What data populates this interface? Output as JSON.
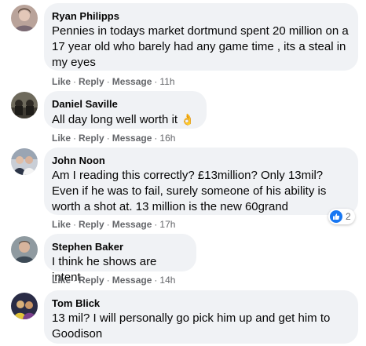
{
  "comments": [
    {
      "name": "Ryan Philipps",
      "text": "Pennies in todays market dortmund spent 20 million on a 17 year old who barely had any game time , its a steal in my eyes",
      "actions": {
        "like": "Like",
        "reply": "Reply",
        "message": "Message",
        "time": "11h"
      }
    },
    {
      "name": "Daniel Saville",
      "text": "All day long well worth it",
      "emoji": "👌",
      "actions": {
        "like": "Like",
        "reply": "Reply",
        "message": "Message",
        "time": "16h"
      }
    },
    {
      "name": "John Noon",
      "text": "Am I reading this correctly? £13million? Only 13mil? Even if he was to fail, surely someone of his ability is worth a shot at. 13 million is the new 60grand",
      "reaction_count": "2",
      "actions": {
        "like": "Like",
        "reply": "Reply",
        "message": "Message",
        "time": "17h"
      }
    },
    {
      "name": "Stephen Baker",
      "text": "I think he shows are intent",
      "actions": {
        "like": "Like",
        "reply": "Reply",
        "message": "Message",
        "time": "14h"
      }
    },
    {
      "name": "Tom Blick",
      "text": "13 mil? I will personally go pick him up and get him to Goodison",
      "actions": {}
    }
  ],
  "colors": {
    "bubble": "#f0f2f5",
    "meta": "#65676b",
    "like_blue": "#1877f2"
  }
}
